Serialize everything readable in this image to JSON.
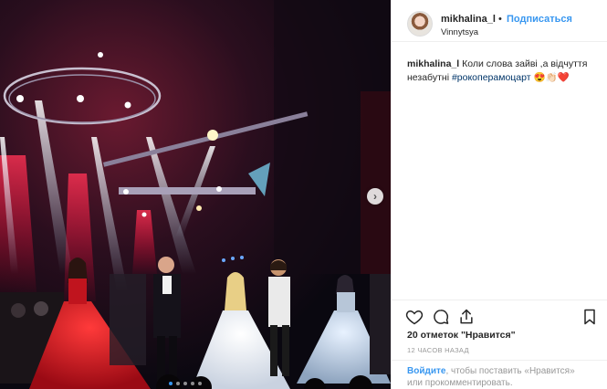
{
  "header": {
    "username": "mikhalina_l",
    "separator": "•",
    "follow_label": "Подписаться",
    "location": "Vinnytsya"
  },
  "caption": {
    "username": "mikhalina_l",
    "text": " Коли слова зайві ,а відчуття незабутні ",
    "hashtag": "#рокоперамоцарт",
    "emoji": " 😍👏🏻❤️"
  },
  "actions": {
    "like_icon": "heart-icon",
    "comment_icon": "comment-icon",
    "share_icon": "share-icon",
    "save_icon": "bookmark-icon"
  },
  "likes_text": "20 отметок \"Нравится\"",
  "time_ago": "12 ЧАСОВ НАЗАД",
  "login_prompt": {
    "link": "Войдите",
    "text": ", чтобы поставить «Нравится» или прокомментировать."
  },
  "carousel": {
    "next_icon": "chevron-right-icon",
    "dots_count": 5,
    "active_dot": 0
  },
  "colors": {
    "accent": "#3897f0",
    "hashtag": "#003569",
    "text": "#262626",
    "muted": "#999999"
  }
}
